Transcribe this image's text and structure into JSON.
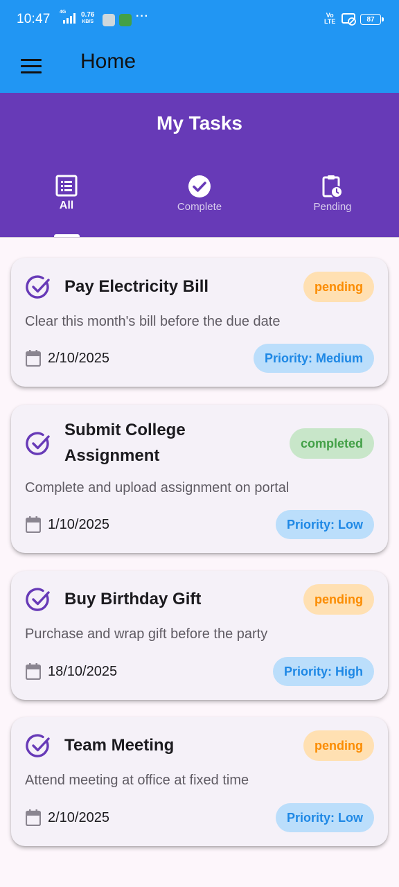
{
  "status_bar": {
    "time": "10:47",
    "network": "4G",
    "speed_value": "0.76",
    "speed_unit": "KB/S",
    "more": "···",
    "volte_top": "Vo",
    "volte_bottom": "LTE",
    "battery": "87"
  },
  "app_bar": {
    "title": "Home",
    "menu_icon": "menu-icon"
  },
  "header": {
    "title": "My Tasks",
    "tabs": [
      {
        "label": "All",
        "icon": "list-icon",
        "active": true
      },
      {
        "label": "Complete",
        "icon": "check-circle-icon",
        "active": false
      },
      {
        "label": "Pending",
        "icon": "clipboard-clock-icon",
        "active": false
      }
    ]
  },
  "colors": {
    "app_bar": "#2196f3",
    "header": "#673ab7",
    "check_icon": "#673ab7",
    "pending_bg": "#ffe0b2",
    "pending_fg": "#fb8c00",
    "completed_bg": "#c8e6c9",
    "completed_fg": "#43a047",
    "priority_bg": "#bbdefb",
    "priority_fg": "#1e88e5"
  },
  "tasks": [
    {
      "title": "Pay Electricity Bill",
      "status": "pending",
      "description": "Clear this month's bill before the due date",
      "date": "2/10/2025",
      "priority": "Priority: Medium"
    },
    {
      "title": "Submit College Assignment",
      "status": "completed",
      "description": "Complete and upload assignment on portal",
      "date": "1/10/2025",
      "priority": "Priority: Low"
    },
    {
      "title": "Buy Birthday Gift",
      "status": "pending",
      "description": "Purchase and wrap gift before the party",
      "date": "18/10/2025",
      "priority": "Priority: High"
    },
    {
      "title": "Team Meeting",
      "status": "pending",
      "description": "Attend meeting at office at fixed time",
      "date": "2/10/2025",
      "priority": "Priority: Low"
    }
  ]
}
